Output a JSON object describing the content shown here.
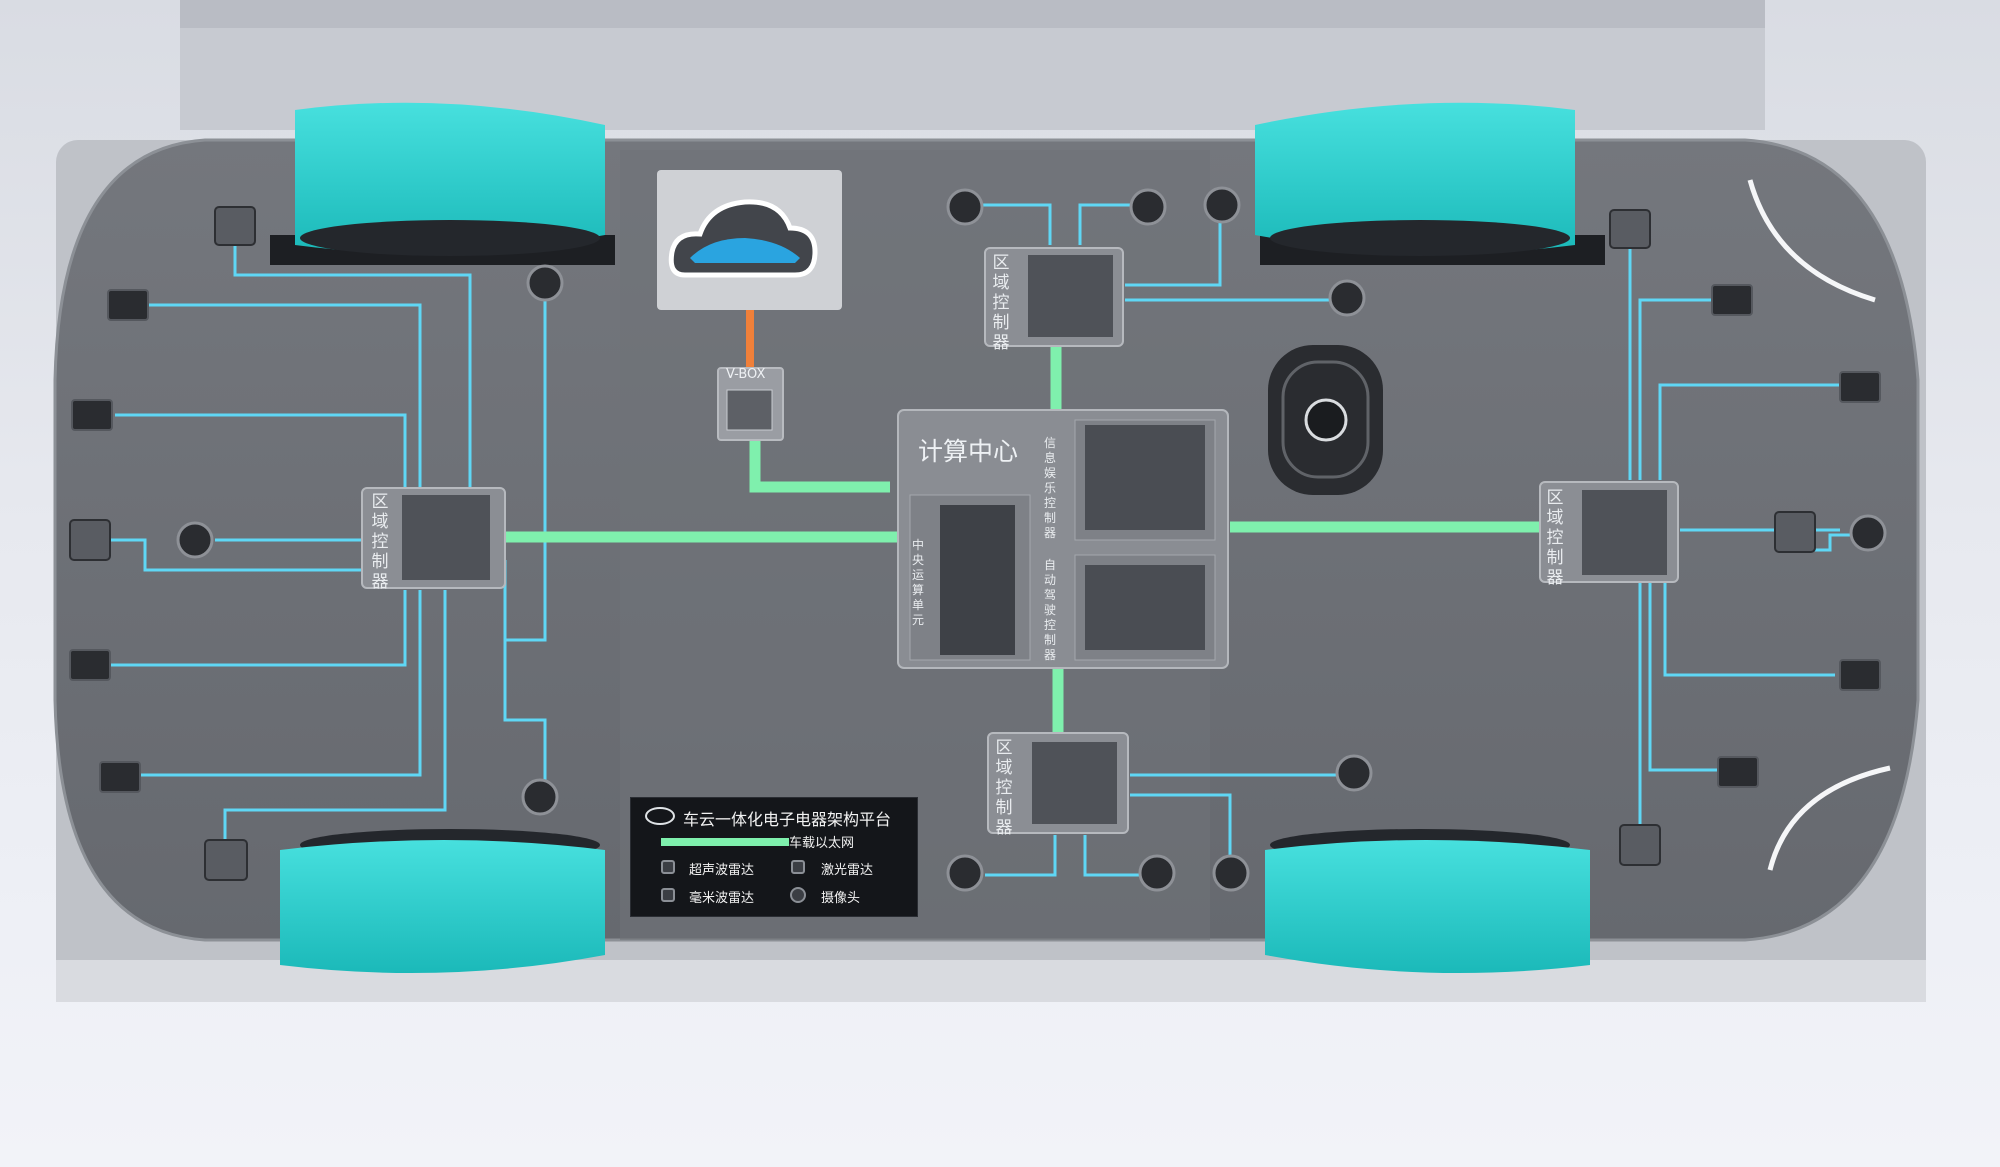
{
  "diagram": {
    "compute_center": {
      "title": "计算中心",
      "infotainment_label": "信息娱乐控制器",
      "central_unit_label": "中央运算单元",
      "autodrive_label": "自动驾驶控制器"
    },
    "zone_controllers": {
      "top_label": "区域控制器",
      "bottom_label": "区域控制器",
      "left_label": "区域控制器",
      "right_label": "区域控制器"
    },
    "vbox_label": "V-BOX",
    "legend": {
      "title": "车云一体化电子电器架构平台",
      "ethernet_label": "车载以太网",
      "ultrasonic_label": "超声波雷达",
      "lidar_label": "激光雷达",
      "mmwave_label": "毫米波雷达",
      "camera_label": "摄像头"
    },
    "colors": {
      "ethernet": "#7ff0ad",
      "sensor_wire": "#5fd7f5",
      "vbox_link": "#f0803a",
      "wheel": "#2fd0cf",
      "chassis": "#6a6d73"
    },
    "icons": [
      "cloud-car-icon",
      "steering-wheel-icon",
      "brand-logo-icon"
    ]
  }
}
